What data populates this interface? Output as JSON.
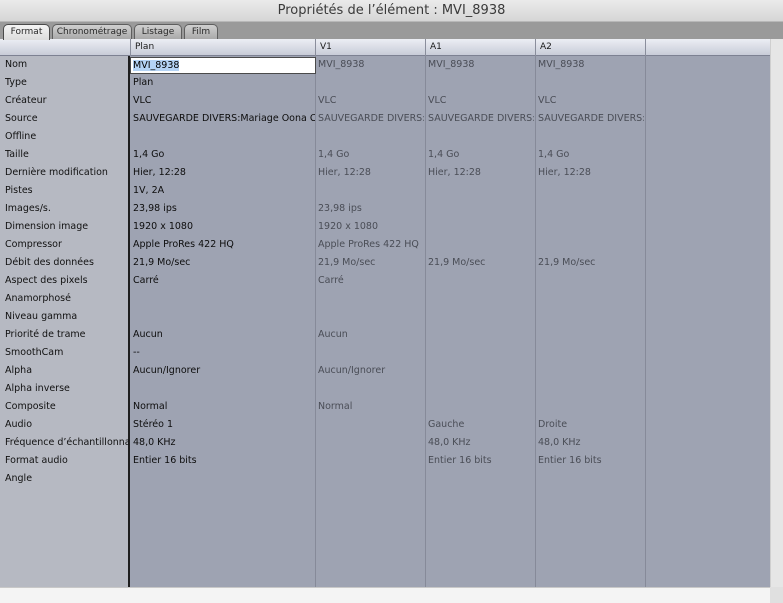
{
  "window": {
    "title": "Propriétés de l’élément : MVI_8938"
  },
  "tabs": [
    {
      "label": "Format",
      "active": true
    },
    {
      "label": "Chronométrage",
      "active": false
    },
    {
      "label": "Listage",
      "active": false
    },
    {
      "label": "Film",
      "active": false
    }
  ],
  "columns": [
    "Plan",
    "V1",
    "A1",
    "A2"
  ],
  "rows": [
    {
      "label": "Nom",
      "values": [
        "MVI_8938",
        "MVI_8938",
        "MVI_8938",
        "MVI_8938"
      ]
    },
    {
      "label": "Type",
      "values": [
        "Plan",
        "",
        "",
        ""
      ]
    },
    {
      "label": "Créateur",
      "values": [
        "VLC",
        "VLC",
        "VLC",
        "VLC"
      ]
    },
    {
      "label": "Source",
      "values": [
        "SAUVEGARDE DIVERS:Mariage Oona Cristi",
        "SAUVEGARDE DIVERS:Ma",
        "SAUVEGARDE DIVERS:Ma",
        "SAUVEGARDE DIVERS:Ma"
      ]
    },
    {
      "label": "Offline",
      "values": [
        "",
        "",
        "",
        ""
      ]
    },
    {
      "label": "Taille",
      "values": [
        "1,4 Go",
        "1,4 Go",
        "1,4 Go",
        "1,4 Go"
      ]
    },
    {
      "label": "Dernière modification",
      "values": [
        "Hier, 12:28",
        "Hier, 12:28",
        "Hier, 12:28",
        "Hier, 12:28"
      ]
    },
    {
      "label": "Pistes",
      "values": [
        "1V, 2A",
        "",
        "",
        ""
      ]
    },
    {
      "label": "Images/s.",
      "values": [
        "23,98 ips",
        "23,98 ips",
        "",
        ""
      ]
    },
    {
      "label": "Dimension image",
      "values": [
        "1920 x 1080",
        "1920 x 1080",
        "",
        ""
      ]
    },
    {
      "label": "Compressor",
      "values": [
        "Apple ProRes 422 HQ",
        "Apple ProRes 422 HQ",
        "",
        ""
      ]
    },
    {
      "label": "Débit des données",
      "values": [
        "21,9 Mo/sec",
        "21,9 Mo/sec",
        "21,9 Mo/sec",
        "21,9 Mo/sec"
      ]
    },
    {
      "label": "Aspect des pixels",
      "values": [
        "Carré",
        "Carré",
        "",
        ""
      ]
    },
    {
      "label": "Anamorphosé",
      "values": [
        "",
        "",
        "",
        ""
      ]
    },
    {
      "label": "Niveau gamma",
      "values": [
        "",
        "",
        "",
        ""
      ]
    },
    {
      "label": "Priorité de trame",
      "values": [
        "Aucun",
        "Aucun",
        "",
        ""
      ]
    },
    {
      "label": "SmoothCam",
      "values": [
        "--",
        "",
        "",
        ""
      ]
    },
    {
      "label": "Alpha",
      "values": [
        "Aucun/Ignorer",
        "Aucun/Ignorer",
        "",
        ""
      ]
    },
    {
      "label": "Alpha inverse",
      "values": [
        "",
        "",
        "",
        ""
      ]
    },
    {
      "label": "Composite",
      "values": [
        "Normal",
        "Normal",
        "",
        ""
      ]
    },
    {
      "label": "Audio",
      "values": [
        "Stéréo 1",
        "",
        "Gauche",
        "Droite"
      ]
    },
    {
      "label": "Fréquence d’échantillonnage",
      "values": [
        "48,0 KHz",
        "",
        "48,0 KHz",
        "48,0 KHz"
      ]
    },
    {
      "label": "Format audio",
      "values": [
        "Entier 16 bits",
        "",
        "Entier 16 bits",
        "Entier 16 bits"
      ]
    },
    {
      "label": "Angle",
      "values": [
        "",
        "",
        "",
        ""
      ]
    }
  ],
  "colors": {
    "grid_bg": "#9ea3b2",
    "label_bg": "#b6b9c2",
    "selection": "#b4d3f5"
  }
}
